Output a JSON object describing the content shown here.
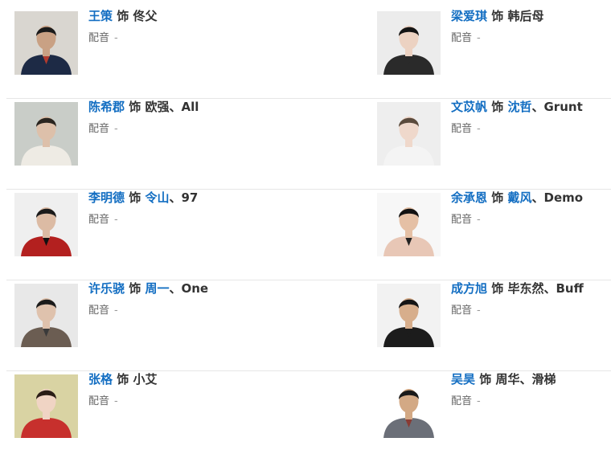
{
  "colors": {
    "link": "#136ec2",
    "text": "#333333",
    "muted": "#666666",
    "divider": "#e6e6e6"
  },
  "voice_label": "配音",
  "voice_value": "-",
  "cast": [
    [
      {
        "actor": "王策",
        "word": "饰",
        "roles": [
          {
            "text": "佟父",
            "link": false
          }
        ],
        "photo": {
          "bg": "#d9d6d0",
          "coat": "#1d2a45",
          "skin": "#c9a184",
          "hair": "#1b1b1b",
          "accent": "#b33a2e"
        }
      },
      {
        "actor": "梁爱琪",
        "word": "饰",
        "roles": [
          {
            "text": "韩后母",
            "link": false
          }
        ],
        "photo": {
          "bg": "#ececec",
          "coat": "#2a2a2a",
          "skin": "#ecd2c2",
          "hair": "#141414",
          "accent": "#2a2a2a"
        }
      }
    ],
    [
      {
        "actor": "陈希郡",
        "word": "饰",
        "roles": [
          {
            "text": "欧强",
            "link": false
          },
          {
            "text": "、",
            "link": false
          },
          {
            "text": "All",
            "link": false
          }
        ],
        "photo": {
          "bg": "#c9cdc8",
          "coat": "#eeebe4",
          "skin": "#ddc0aa",
          "hair": "#2a2520",
          "accent": "#eeebe4"
        }
      },
      {
        "actor": "文苡帆",
        "word": "饰",
        "roles": [
          {
            "text": "沈哲",
            "link": true
          },
          {
            "text": "、",
            "link": false
          },
          {
            "text": "Grunt",
            "link": false
          }
        ],
        "photo": {
          "bg": "#eeeeee",
          "coat": "#f4f4f4",
          "skin": "#efd8cb",
          "hair": "#5a4a3c",
          "accent": "#f4f4f4"
        }
      }
    ],
    [
      {
        "actor": "李明德",
        "word": "饰",
        "roles": [
          {
            "text": "令山",
            "link": true
          },
          {
            "text": "、",
            "link": false
          },
          {
            "text": "97",
            "link": false
          }
        ],
        "photo": {
          "bg": "#efefef",
          "coat": "#b3201f",
          "skin": "#dcbba4",
          "hair": "#1a1a1a",
          "accent": "#111111"
        }
      },
      {
        "actor": "余承恩",
        "word": "饰",
        "roles": [
          {
            "text": "戴风",
            "link": true
          },
          {
            "text": "、",
            "link": false
          },
          {
            "text": "Demo",
            "link": false
          }
        ],
        "photo": {
          "bg": "#f7f7f7",
          "coat": "#e8c7b6",
          "skin": "#e5c0a5",
          "hair": "#121212",
          "accent": "#222222"
        }
      }
    ],
    [
      {
        "actor": "许乐骁",
        "word": "饰",
        "roles": [
          {
            "text": "周一",
            "link": true
          },
          {
            "text": "、",
            "link": false
          },
          {
            "text": "One",
            "link": false
          }
        ],
        "photo": {
          "bg": "#e8e8e8",
          "coat": "#6b5d52",
          "skin": "#dfc2ad",
          "hair": "#1b1b1b",
          "accent": "#3a3a3a"
        }
      },
      {
        "actor": "成方旭",
        "word": "饰",
        "roles": [
          {
            "text": "毕东然",
            "link": false
          },
          {
            "text": "、",
            "link": false
          },
          {
            "text": "Buff",
            "link": false
          }
        ],
        "photo": {
          "bg": "#f2f2f2",
          "coat": "#1c1c1c",
          "skin": "#d7ae8c",
          "hair": "#151515",
          "accent": "#1c1c1c"
        }
      }
    ],
    [
      {
        "actor": "张格",
        "word": "饰",
        "roles": [
          {
            "text": "小艾",
            "link": false
          }
        ],
        "photo": {
          "bg": "#d9d3a3",
          "coat": "#c7302d",
          "skin": "#f0d4c4",
          "hair": "#2a1d16",
          "accent": "#c7302d"
        }
      },
      {
        "actor": "吴昊",
        "word": "饰",
        "roles": [
          {
            "text": "周华",
            "link": false
          },
          {
            "text": "、",
            "link": false
          },
          {
            "text": "滑梯",
            "link": false
          }
        ],
        "photo": {
          "bg": "#ffffff",
          "coat": "#6b6f78",
          "skin": "#d3a985",
          "hair": "#1a1a1a",
          "accent": "#8a3b34"
        }
      }
    ]
  ]
}
